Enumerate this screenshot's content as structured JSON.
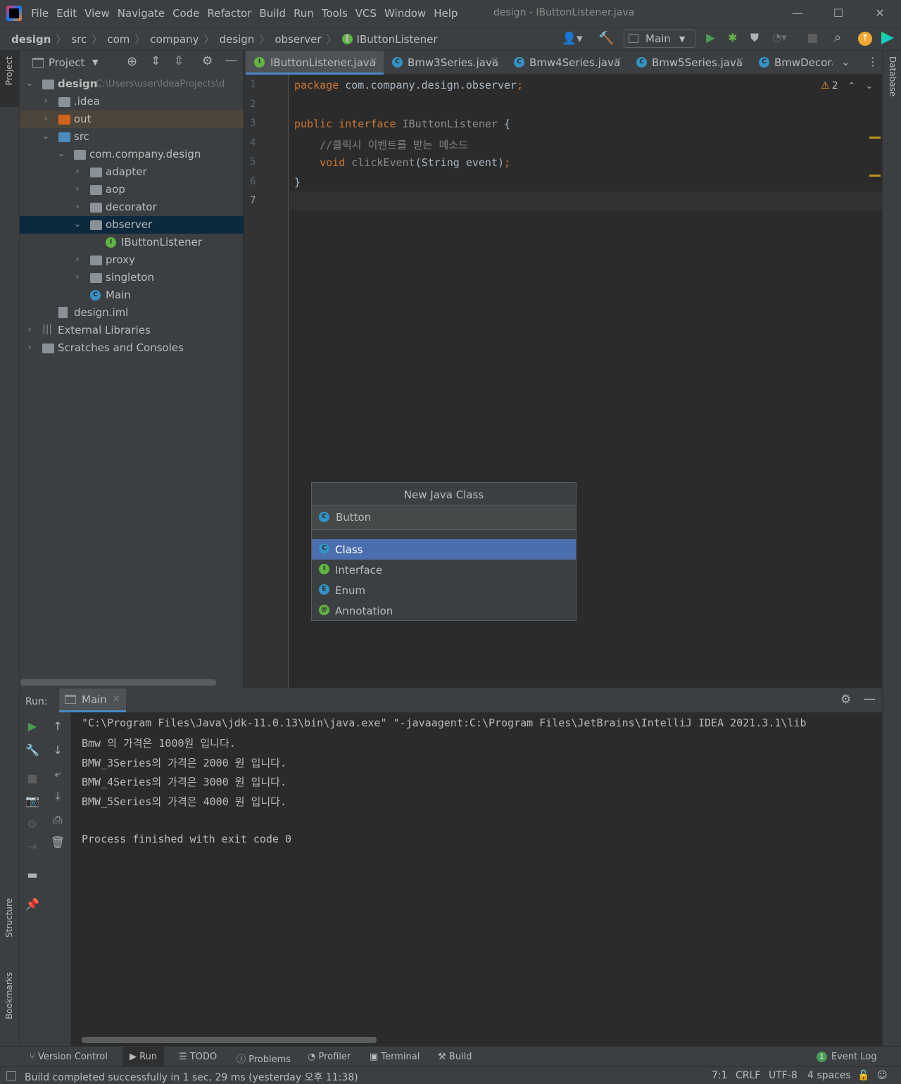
{
  "window": {
    "title": "design - IButtonListener.java",
    "menu": [
      "File",
      "Edit",
      "View",
      "Navigate",
      "Code",
      "Refactor",
      "Build",
      "Run",
      "Tools",
      "VCS",
      "Window",
      "Help"
    ]
  },
  "breadcrumb": [
    "design",
    "src",
    "com",
    "company",
    "design",
    "observer",
    "IButtonListener"
  ],
  "run_config": "Main",
  "project_panel": {
    "title": "Project",
    "root_name": "design",
    "root_path": "C:\\Users\\user\\IdeaProjects\\d",
    "items": [
      {
        "label": ".idea"
      },
      {
        "label": "out"
      },
      {
        "label": "src"
      },
      {
        "label": "com.company.design"
      },
      {
        "label": "adapter"
      },
      {
        "label": "aop"
      },
      {
        "label": "decorator"
      },
      {
        "label": "observer"
      },
      {
        "label": "IButtonListener"
      },
      {
        "label": "proxy"
      },
      {
        "label": "singleton"
      },
      {
        "label": "Main"
      },
      {
        "label": "design.iml"
      },
      {
        "label": "External Libraries"
      },
      {
        "label": "Scratches and Consoles"
      }
    ]
  },
  "tabs": [
    "IButtonListener.java",
    "Bmw3Series.java",
    "Bmw4Series.java",
    "Bmw5Series.java",
    "BmwDecora"
  ],
  "editor": {
    "line_numbers": [
      "1",
      "2",
      "3",
      "4",
      "5",
      "6",
      "7"
    ],
    "code": {
      "l1_kw": "package",
      "l1_rest": " com.company.design.observer",
      "l1_semi": ";",
      "l3_kw1": "public",
      "l3_kw2": "interface",
      "l3_name": "IButtonListener",
      "l3_brace": " {",
      "l4_comment": "    //클릭시 이벤트를 받는 메소드",
      "l5_kw": "    void",
      "l5_fn": " clickEvent",
      "l5_args": "(String event)",
      "l5_semi": ";",
      "l6": "}"
    },
    "warnings_count": "2"
  },
  "popup": {
    "title": "New Java Class",
    "input_value": "Button",
    "options": [
      "Class",
      "Interface",
      "Enum",
      "Annotation"
    ],
    "selected": "Class"
  },
  "run_panel": {
    "label": "Run:",
    "tab": "Main",
    "console": [
      "\"C:\\Program Files\\Java\\jdk-11.0.13\\bin\\java.exe\" \"-javaagent:C:\\Program Files\\JetBrains\\IntelliJ IDEA 2021.3.1\\lib",
      "Bmw 의 가격은 1000원 입니다.",
      "BMW_3Series의 가격은 2000 원 입니다.",
      "BMW_4Series의 가격은 3000 원 입니다.",
      "BMW_5Series의 가격은 4000 원 입니다.",
      "",
      "Process finished with exit code 0"
    ]
  },
  "left_strip": {
    "project": "Project",
    "structure": "Structure",
    "bookmarks": "Bookmarks"
  },
  "right_strip": {
    "database": "Database"
  },
  "bottom_tools": [
    "Version Control",
    "Run",
    "TODO",
    "Problems",
    "Profiler",
    "Terminal",
    "Build"
  ],
  "event_log": {
    "count": "1",
    "label": "Event Log"
  },
  "status": {
    "message": "Build completed successfully in 1 sec, 29 ms (yesterday 오후 11:38)",
    "position": "7:1",
    "line_sep": "CRLF",
    "encoding": "UTF-8",
    "indent": "4 spaces"
  },
  "colors": {
    "accent": "#4b6eaf",
    "keyword": "#cc7832",
    "background": "#2b2b2b",
    "panel": "#3c3f41"
  }
}
